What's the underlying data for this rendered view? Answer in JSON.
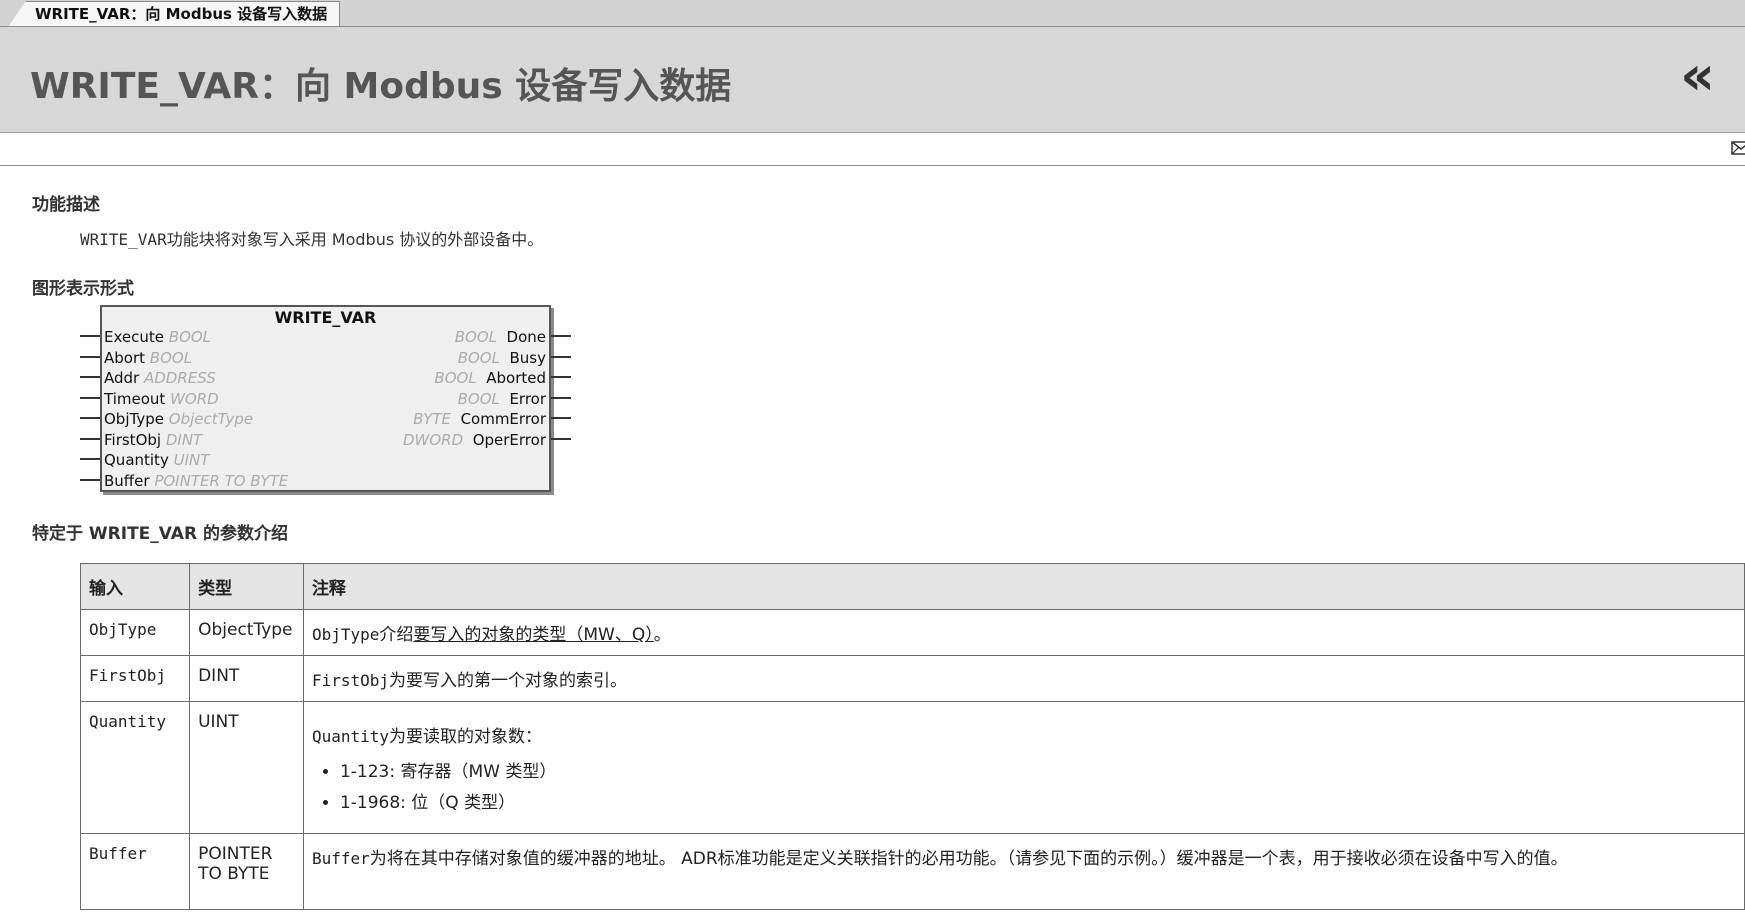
{
  "tab": {
    "label": "WRITE_VAR：向 Modbus 设备写入数据"
  },
  "header": {
    "title": "WRITE_VAR：向 Modbus 设备写入数据",
    "collapse_glyph": "«"
  },
  "sections": {
    "function_description": {
      "heading": "功能描述",
      "text_mono": "WRITE_VAR",
      "text_rest": "功能块将对象写入采用 Modbus 协议的外部设备中。"
    },
    "graphical_representation": {
      "heading": "图形表示形式"
    },
    "parameters": {
      "heading": "特定于 WRITE_VAR 的参数介绍"
    }
  },
  "function_block": {
    "name": "WRITE_VAR",
    "inputs": [
      {
        "name": "Execute",
        "type": "BOOL"
      },
      {
        "name": "Abort",
        "type": "BOOL"
      },
      {
        "name": "Addr",
        "type": "ADDRESS"
      },
      {
        "name": "Timeout",
        "type": "WORD"
      },
      {
        "name": "ObjType",
        "type": "ObjectType"
      },
      {
        "name": "FirstObj",
        "type": "DINT"
      },
      {
        "name": "Quantity",
        "type": "UINT"
      },
      {
        "name": "Buffer",
        "type": "POINTER TO BYTE"
      }
    ],
    "outputs": [
      {
        "name": "Done",
        "type": "BOOL"
      },
      {
        "name": "Busy",
        "type": "BOOL"
      },
      {
        "name": "Aborted",
        "type": "BOOL"
      },
      {
        "name": "Error",
        "type": "BOOL"
      },
      {
        "name": "CommError",
        "type": "BYTE"
      },
      {
        "name": "OperError",
        "type": "DWORD"
      }
    ]
  },
  "table": {
    "headers": [
      "输入",
      "类型",
      "注释"
    ],
    "rows": [
      {
        "input": "ObjType",
        "type": "ObjectType",
        "note_mono": "ObjType",
        "note_prefix": "介绍",
        "note_link": "要写入的对象的类型（MW、Q）",
        "note_suffix": "。"
      },
      {
        "input": "FirstObj",
        "type": "DINT",
        "note_mono": "FirstObj",
        "note_rest": "为要写入的第一个对象的索引。"
      },
      {
        "input": "Quantity",
        "type": "UINT",
        "note_mono": "Quantity",
        "note_rest": "为要读取的对象数：",
        "bullets": [
          "1-123: 寄存器（MW 类型）",
          "1-1968: 位（Q 类型）"
        ]
      },
      {
        "input": "Buffer",
        "type": "POINTER TO BYTE",
        "note_mono": "Buffer",
        "note_rest": "为将在其中存储对象值的缓冲器的地址。 ADR标准功能是定义关联指针的必用功能。（请参见下面的示例。）缓冲器是一个表，用于接收必须在设备中写入的值。"
      }
    ]
  }
}
